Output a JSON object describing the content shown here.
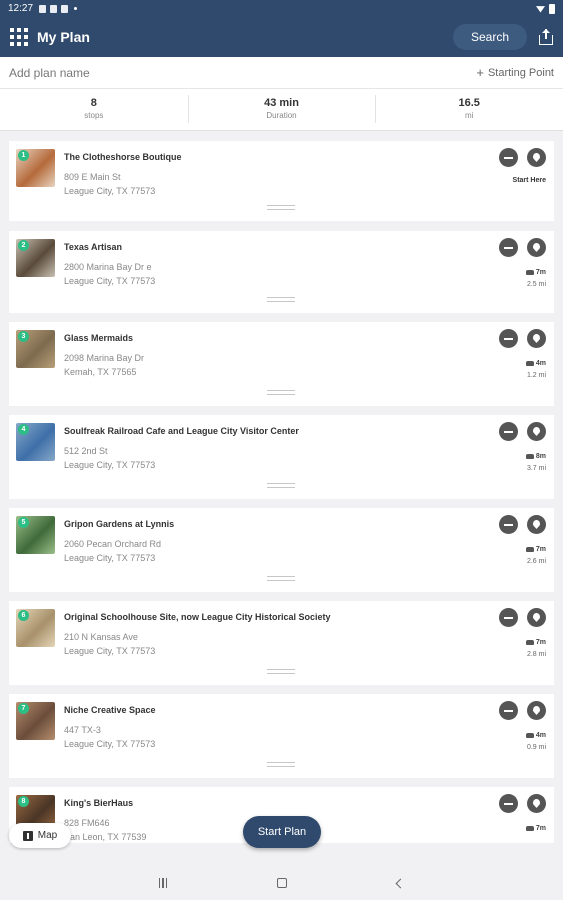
{
  "status_bar": {
    "time": "12:27"
  },
  "app_bar": {
    "title": "My Plan",
    "search_label": "Search"
  },
  "plan": {
    "name_placeholder": "Add plan name",
    "starting_point_label": "Starting Point"
  },
  "stats": [
    {
      "value": "8",
      "label": "stops"
    },
    {
      "value": "43 min",
      "label": "Duration"
    },
    {
      "value": "16.5",
      "label": "mi"
    }
  ],
  "stops": [
    {
      "number": "1",
      "name": "The Clotheshorse Boutique",
      "address1": "809 E Main St",
      "address2": "League City, TX 77573",
      "start_label": "Start Here",
      "time": "",
      "distance": "",
      "thumb_colors": [
        "#b56a3b",
        "#e8d4c0"
      ]
    },
    {
      "number": "2",
      "name": "Texas Artisan",
      "address1": "2800 Marina Bay Dr e",
      "address2": "League City, TX 77573",
      "start_label": "",
      "time": "7m",
      "distance": "2.5 mi",
      "thumb_colors": [
        "#5a4a3a",
        "#c9c2b5"
      ]
    },
    {
      "number": "3",
      "name": "Glass Mermaids",
      "address1": "2098 Marina Bay Dr",
      "address2": "Kemah, TX 77565",
      "start_label": "",
      "time": "4m",
      "distance": "1.2 mi",
      "thumb_colors": [
        "#7d6a4e",
        "#b9a07a"
      ]
    },
    {
      "number": "4",
      "name": "Soulfreak Railroad Cafe and League City Visitor Center",
      "address1": "512 2nd St",
      "address2": "League City, TX 77573",
      "start_label": "",
      "time": "8m",
      "distance": "3.7 mi",
      "thumb_colors": [
        "#3e6fa8",
        "#87a9c9"
      ]
    },
    {
      "number": "5",
      "name": "Gripon Gardens at Lynnis",
      "address1": "2060 Pecan Orchard Rd",
      "address2": "League City, TX 77573",
      "start_label": "",
      "time": "7m",
      "distance": "2.6 mi",
      "thumb_colors": [
        "#3f6a3a",
        "#9bbf8a"
      ]
    },
    {
      "number": "6",
      "name": "Original Schoolhouse Site, now League City Historical Society",
      "address1": "210 N Kansas Ave",
      "address2": "League City, TX 77573",
      "start_label": "",
      "time": "7m",
      "distance": "2.8 mi",
      "thumb_colors": [
        "#a8916b",
        "#e4d6b8"
      ]
    },
    {
      "number": "7",
      "name": "Niche Creative Space",
      "address1": "447 TX-3",
      "address2": "League City, TX 77573",
      "start_label": "",
      "time": "4m",
      "distance": "0.9 mi",
      "thumb_colors": [
        "#6b4d3b",
        "#b58e6e"
      ]
    },
    {
      "number": "8",
      "name": "King's BierHaus",
      "address1": "828 FM646",
      "address2": "San Leon, TX 77539",
      "start_label": "",
      "time": "7m",
      "distance": "",
      "thumb_colors": [
        "#4a3526",
        "#9b6b42"
      ]
    }
  ],
  "floating": {
    "map_label": "Map",
    "start_plan_label": "Start Plan"
  },
  "colors": {
    "primary": "#2f4a6d",
    "badge": "#2dbe86"
  }
}
